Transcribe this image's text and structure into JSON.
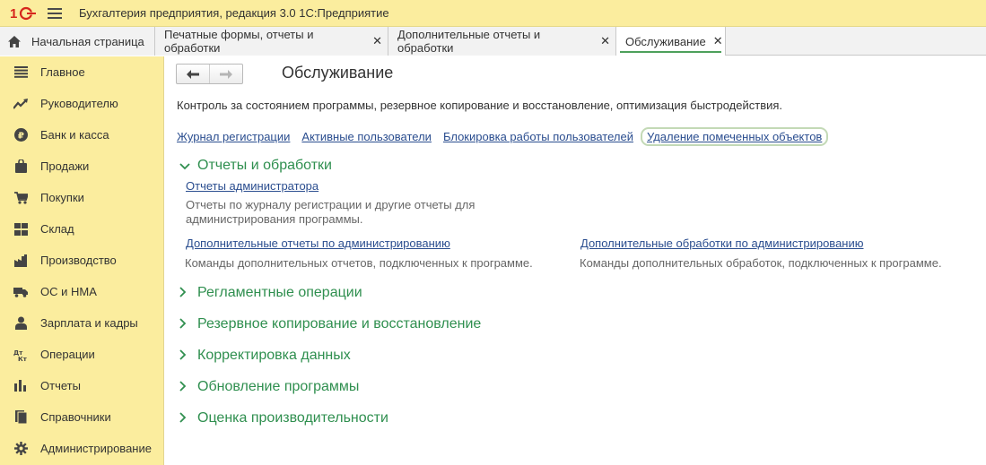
{
  "app": {
    "title": "Бухгалтерия предприятия, редакция 3.0 1С:Предприятие",
    "logo_text": "1С"
  },
  "tabs": [
    {
      "label": "Начальная страница",
      "closable": false,
      "active": false
    },
    {
      "label": "Печатные формы, отчеты и обработки",
      "closable": true,
      "active": false
    },
    {
      "label": "Дополнительные отчеты и обработки",
      "closable": true,
      "active": false
    },
    {
      "label": "Обслуживание",
      "closable": true,
      "active": true
    }
  ],
  "tab_close_glyph": "✕",
  "sidebar": {
    "items": [
      {
        "label": "Главное",
        "icon": "menu-lines-icon"
      },
      {
        "label": "Руководителю",
        "icon": "trend-icon"
      },
      {
        "label": "Банк и касса",
        "icon": "ruble-coin-icon"
      },
      {
        "label": "Продажи",
        "icon": "shopping-bag-icon"
      },
      {
        "label": "Покупки",
        "icon": "cart-icon"
      },
      {
        "label": "Склад",
        "icon": "warehouse-grid-icon"
      },
      {
        "label": "Производство",
        "icon": "factory-icon"
      },
      {
        "label": "ОС и НМА",
        "icon": "truck-icon"
      },
      {
        "label": "Зарплата и кадры",
        "icon": "person-icon"
      },
      {
        "label": "Операции",
        "icon": "dt-kt-icon"
      },
      {
        "label": "Отчеты",
        "icon": "bar-chart-icon"
      },
      {
        "label": "Справочники",
        "icon": "books-icon"
      },
      {
        "label": "Администрирование",
        "icon": "gear-icon"
      }
    ]
  },
  "main": {
    "title": "Обслуживание",
    "description": "Контроль за состоянием программы, резервное копирование и восстановление, оптимизация быстродействия.",
    "top_links": [
      "Журнал регистрации",
      "Активные пользователи",
      "Блокировка работы пользователей",
      "Удаление помеченных объектов"
    ],
    "reports_group": {
      "title": "Отчеты и обработки",
      "admin_reports_link": "Отчеты администратора",
      "admin_reports_desc_line1": "Отчеты по журналу регистрации и другие отчеты для",
      "admin_reports_desc_line2": "администрирования программы.",
      "additional_reports_link": "Дополнительные отчеты по администрированию",
      "additional_reports_desc": "Команды дополнительных отчетов, подключенных к программе.",
      "additional_processing_link": "Дополнительные обработки по администрированию",
      "additional_processing_desc": "Команды дополнительных обработок, подключенных к программе."
    },
    "collapsed_groups": [
      "Регламентные операции",
      "Резервное копирование и восстановление",
      "Корректировка данных",
      "Обновление программы",
      "Оценка производительности"
    ]
  },
  "colors": {
    "header_bg": "#fbed9e",
    "group_title": "#2f8f4f",
    "link": "#2a4d8f",
    "active_tab_underline": "#4da05b"
  }
}
